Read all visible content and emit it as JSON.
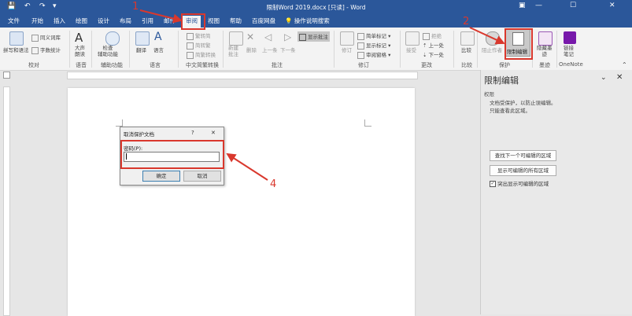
{
  "quick_access": [
    "💾",
    "↶",
    "↷",
    "▾"
  ],
  "title": "限制Word 2019.docx [只读] - Word",
  "tabs": [
    "文件",
    "开始",
    "插入",
    "绘图",
    "设计",
    "布局",
    "引用",
    "邮件",
    "审阅",
    "视图",
    "帮助",
    "百度网盘"
  ],
  "active_tab": "审阅",
  "tell_me": "操作说明搜索",
  "ribbon": {
    "proofing": {
      "spelling": "拼写和语法",
      "word_count": "字数统计",
      "thesaurus": "同义词库",
      "label": "校对"
    },
    "speech": {
      "read_aloud": "大声\n朗读",
      "label": "语音"
    },
    "accessibility": {
      "check": "检查\n辅助功能",
      "label": "辅助功能"
    },
    "language": {
      "translate": "翻译",
      "language": "语言",
      "label": "语言"
    },
    "chinese_conv": {
      "to_simplified": "繁转简",
      "to_traditional": "简转繁",
      "convert": "简繁转换",
      "label": "中文简繁转换"
    },
    "comments": {
      "new": "新建\n批注",
      "delete": "删除",
      "previous": "上一条",
      "next": "下一条",
      "show": "显示批注",
      "label": "批注"
    },
    "tracking": {
      "track": "修订",
      "markup": "简单标记",
      "show_markup": "显示标记",
      "pane": "审阅窗格",
      "label": "修订"
    },
    "changes": {
      "accept": "接受",
      "reject": "拒绝",
      "previous": "上一处",
      "next": "下一处",
      "label": "更改"
    },
    "compare": {
      "compare": "比较",
      "label": "比较"
    },
    "protect": {
      "block_authors": "阻止作者",
      "restrict": "限制编辑",
      "label": "保护"
    },
    "ink": {
      "hide_ink": "隐藏墨\n迹",
      "label": "墨迹"
    },
    "onenote": {
      "linked_notes": "链接\n笔记",
      "label": "OneNote"
    }
  },
  "pane": {
    "title": "限制编辑",
    "section": "权限",
    "text": "文档受保护，以防止误编辑。\n只能查看此区域。",
    "btn_next": "查找下一个可编辑的区域",
    "btn_show_all": "显示可编辑的所有区域",
    "checkbox": "突出显示可编辑的区域",
    "checkbox_checked": true
  },
  "dialog": {
    "title": "取消保护文档",
    "help": "?",
    "close": "✕",
    "password_label": "密码(P):",
    "password_value": "",
    "ok": "确定",
    "cancel": "取消"
  },
  "annotations": [
    "1",
    "2",
    "4"
  ],
  "colors": {
    "accent": "#2b579a",
    "annotation": "#d9382d"
  }
}
